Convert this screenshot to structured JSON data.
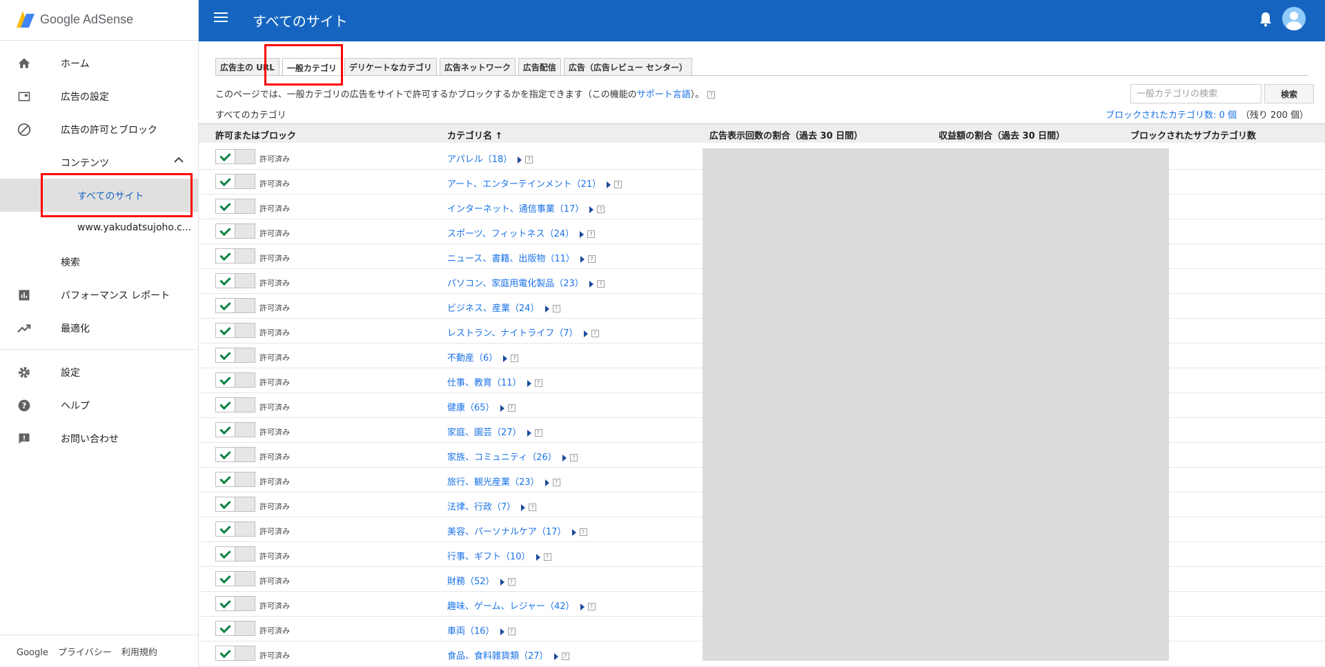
{
  "app": {
    "logo_text": "Google AdSense"
  },
  "sidebar": {
    "items": [
      {
        "label": "ホーム",
        "icon": "home-icon"
      },
      {
        "label": "広告の設定",
        "icon": "ad-units-icon"
      },
      {
        "label": "広告の許可とブロック",
        "icon": "block-icon"
      },
      {
        "label": "コンテンツ",
        "icon": ""
      },
      {
        "label": "すべてのサイト",
        "icon": ""
      },
      {
        "label": "www.yakudatsujoho.c...",
        "icon": ""
      },
      {
        "label": "検索",
        "icon": ""
      },
      {
        "label": "パフォーマンス レポート",
        "icon": "bar-chart-icon"
      },
      {
        "label": "最適化",
        "icon": "trending-up-icon"
      },
      {
        "label": "設定",
        "icon": "gear-icon"
      },
      {
        "label": "ヘルプ",
        "icon": "help-icon"
      },
      {
        "label": "お問い合わせ",
        "icon": "feedback-icon"
      }
    ],
    "footer": {
      "google": "Google",
      "privacy": "プライバシー",
      "terms": "利用規約"
    }
  },
  "header": {
    "title": "すべてのサイト"
  },
  "tabs": [
    {
      "label": "広告主の URL"
    },
    {
      "label": "一般カテゴリ"
    },
    {
      "label": "デリケートなカテゴリ"
    },
    {
      "label": "広告ネットワーク"
    },
    {
      "label": "広告配信"
    },
    {
      "label": "広告（広告レビュー センター）"
    }
  ],
  "intro": {
    "text": "このページでは、一般カテゴリの広告をサイトで許可するかブロックするかを指定できます（この機能の",
    "link": "サポート言語",
    "suffix": "）。",
    "help": "?"
  },
  "all_categories_label": "すべてのカテゴリ",
  "search": {
    "placeholder": "一般カテゴリの検索",
    "button": "検索"
  },
  "blocked_summary": {
    "link": "ブロックされたカテゴリ数: 0 個",
    "rest": "（残り 200 個）"
  },
  "table": {
    "headers": {
      "allow_block": "許可またはブロック",
      "category": "カテゴリ名 ↑",
      "impressions": "広告表示回数の割合（過去 30 日間）",
      "earnings": "収益額の割合（過去 30 日間）",
      "blocked_sub": "ブロックされたサブカテゴリ数"
    },
    "status_label": "許可済み",
    "rows": [
      {
        "category": "アパレル（18）"
      },
      {
        "category": "アート、エンターテインメント（21）"
      },
      {
        "category": "インターネット、通信事業（17）"
      },
      {
        "category": "スポーツ、フィットネス（24）"
      },
      {
        "category": "ニュース、書籍、出版物（11）"
      },
      {
        "category": "パソコン、家庭用電化製品（23）"
      },
      {
        "category": "ビジネス、産業（24）"
      },
      {
        "category": "レストラン、ナイトライフ（7）"
      },
      {
        "category": "不動産（6）"
      },
      {
        "category": "仕事、教育（11）"
      },
      {
        "category": "健康（65）"
      },
      {
        "category": "家庭、園芸（27）"
      },
      {
        "category": "家族、コミュニティ（26）"
      },
      {
        "category": "旅行、観光産業（23）"
      },
      {
        "category": "法律、行政（7）"
      },
      {
        "category": "美容、パーソナルケア（17）"
      },
      {
        "category": "行事、ギフト（10）"
      },
      {
        "category": "財務（52）"
      },
      {
        "category": "趣味、ゲーム、レジャー（42）"
      },
      {
        "category": "車両（16）"
      },
      {
        "category": "食品、食料雑貨類（27）"
      }
    ]
  },
  "colors": {
    "header_bg": "#1565c0",
    "link": "#1a73e8",
    "check": "#0b8043",
    "highlight": "#ff0000"
  }
}
